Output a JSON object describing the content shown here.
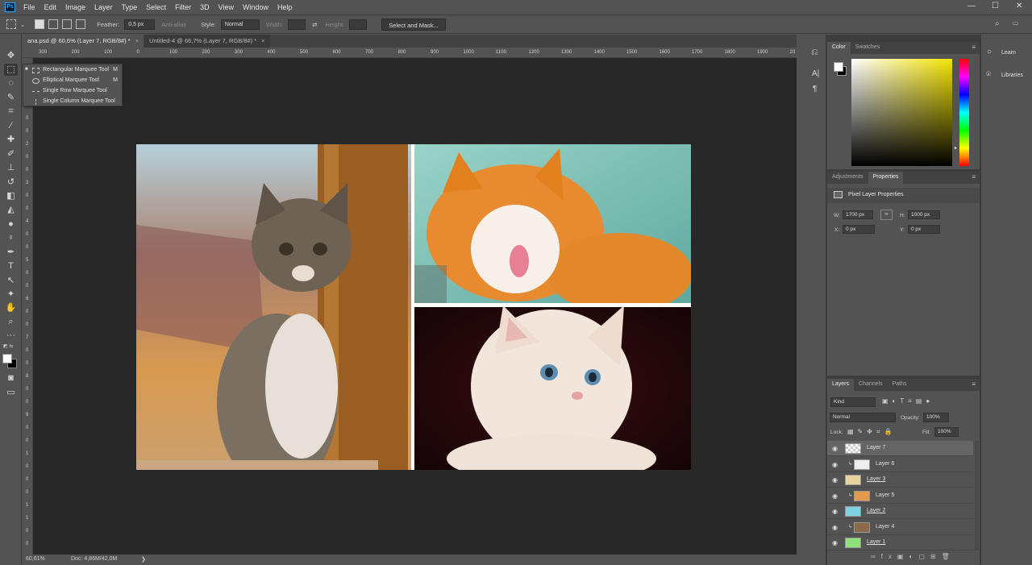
{
  "app": {
    "logo_text": "Ps"
  },
  "menu": [
    "File",
    "Edit",
    "Image",
    "Layer",
    "Type",
    "Select",
    "Filter",
    "3D",
    "View",
    "Window",
    "Help"
  ],
  "window_controls": {
    "minimize": "—",
    "maximize": "☐",
    "close": "✕"
  },
  "options": {
    "feather_label": "Feather:",
    "feather_value": "0,5 px",
    "antialias_label": "Anti-alias",
    "style_label": "Style:",
    "style_value": "Normal",
    "width_label": "Width:",
    "height_label": "Height:",
    "select_mask_label": "Select and Mask..."
  },
  "tabs": [
    {
      "label": "ana.psd @ 60,6% (Layer 7, RGB/8#) *",
      "close": "×"
    },
    {
      "label": "Untitled-4 @ 66,7% (Layer 7, RGB/8#) *",
      "close": "×"
    }
  ],
  "hruler": [
    "300",
    "200",
    "100",
    "0",
    "100",
    "200",
    "300",
    "400",
    "500",
    "600",
    "700",
    "800",
    "900",
    "1000",
    "1100",
    "1200",
    "1300",
    "1400",
    "1500",
    "1600",
    "1700",
    "1800",
    "1900",
    "20"
  ],
  "vruler": [
    "1",
    "0",
    "0",
    "1",
    "0",
    "0",
    "2",
    "0",
    "0",
    "3",
    "0",
    "0",
    "4",
    "0",
    "0",
    "5",
    "0",
    "0",
    "6",
    "0",
    "0",
    "7",
    "0",
    "0",
    "8",
    "0",
    "0",
    "9",
    "0",
    "0",
    "1",
    "0",
    "0",
    "0",
    "1",
    "1",
    "0",
    "0"
  ],
  "flyout": [
    {
      "label": "Rectangular Marquee Tool",
      "key": "M"
    },
    {
      "label": "Elliptical Marquee Tool",
      "key": "M"
    },
    {
      "label": "Single Row Marquee Tool",
      "key": ""
    },
    {
      "label": "Single Column Marquee Tool",
      "key": ""
    }
  ],
  "status": {
    "zoom": "60,61%",
    "doc": "Doc: 4,86M/42,0M",
    "arrow": "❯"
  },
  "color_panel": {
    "tabs": [
      "Color",
      "Swatches"
    ]
  },
  "properties_panel": {
    "tabs": [
      "Adjustments",
      "Properties"
    ],
    "heading": "Pixel Layer Properties",
    "w_label": "W:",
    "w_value": "1700 px",
    "h_label": "H:",
    "h_value": "1000 px",
    "x_label": "X:",
    "x_value": "0 px",
    "y_label": "Y:",
    "y_value": "0 px"
  },
  "layers_panel": {
    "tabs": [
      "Layers",
      "Channels",
      "Paths"
    ],
    "filter_label": "Kind",
    "blend_mode": "Normal",
    "opacity_label": "Opacity:",
    "opacity_value": "100%",
    "lock_label": "Lock:",
    "fill_label": "Fill:",
    "fill_value": "100%",
    "layers": [
      {
        "name": "Layer 7",
        "clip": false
      },
      {
        "name": "Layer 6",
        "clip": true
      },
      {
        "name": "Layer 3",
        "clip": false
      },
      {
        "name": "Layer 5",
        "clip": true
      },
      {
        "name": "Layer 2",
        "clip": false
      },
      {
        "name": "Layer 4",
        "clip": true
      },
      {
        "name": "Layer 1",
        "clip": false
      }
    ]
  },
  "learn_panel": {
    "learn_label": "Learn",
    "libraries_label": "Libraries"
  }
}
